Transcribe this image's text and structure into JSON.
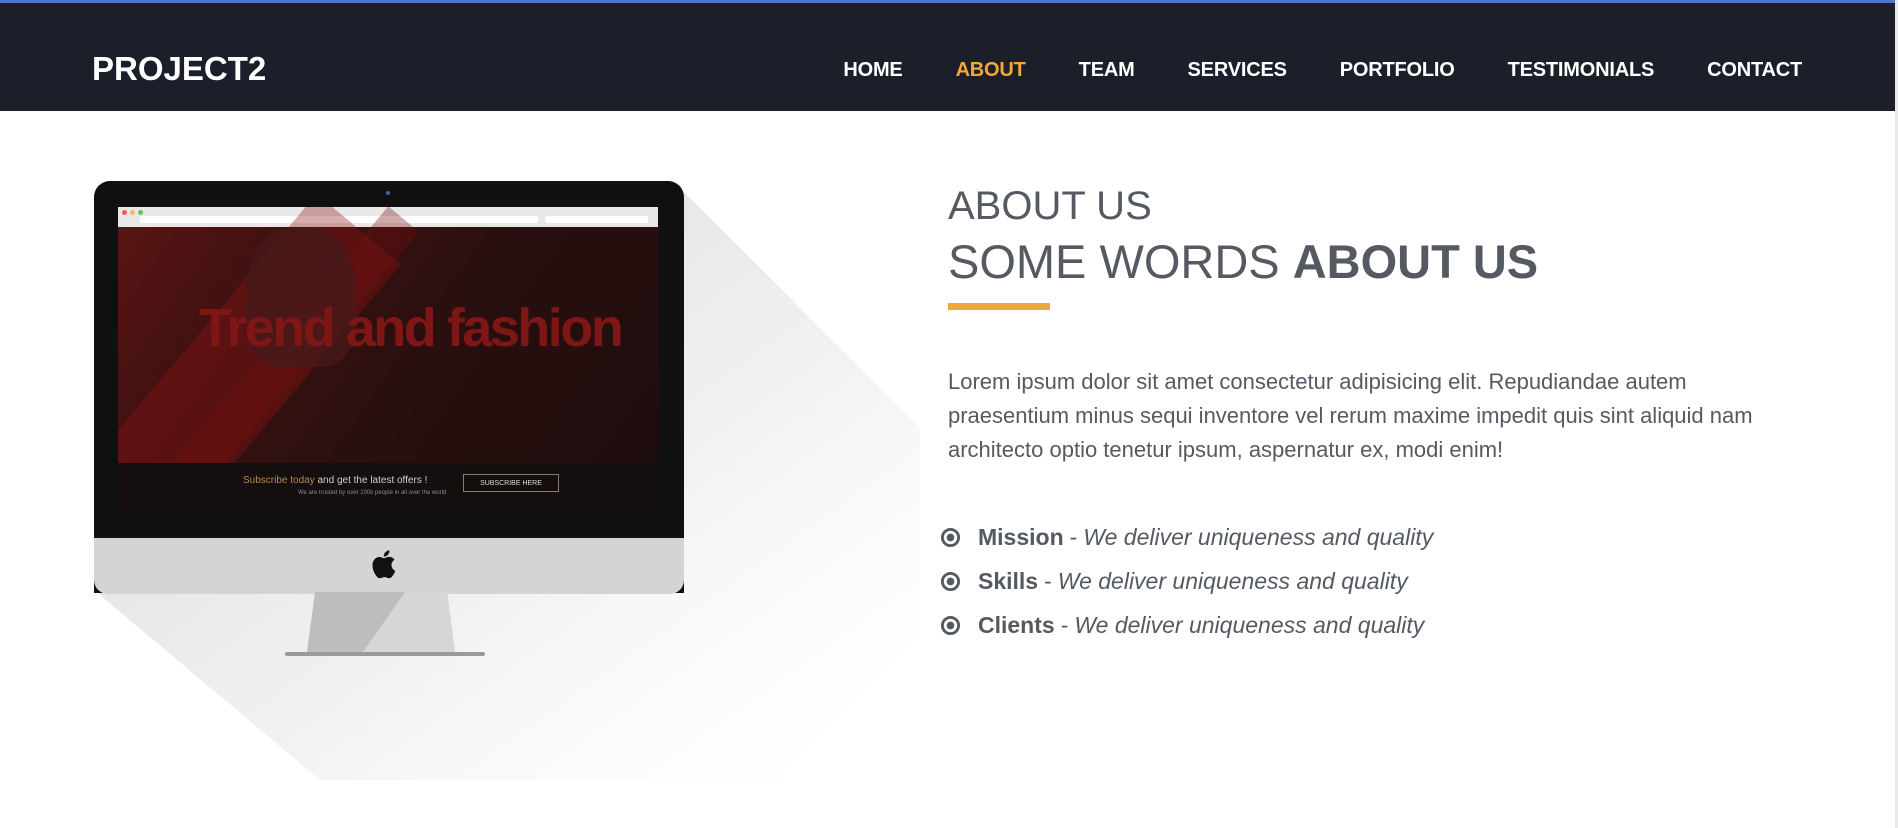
{
  "brand": "PROJECT2",
  "nav": [
    "HOME",
    "ABOUT",
    "TEAM",
    "SERVICES",
    "PORTFOLIO",
    "TESTIMONIALS",
    "CONTACT"
  ],
  "nav_active": "ABOUT",
  "colors": {
    "navbar": "#1c1f29",
    "accent": "#f2a73b",
    "text": "#555a62",
    "topline": "#4a7ac8"
  },
  "mockup": {
    "hero_title": "Trend and fashion",
    "subscribe_text_highlight": "Subscribe today",
    "subscribe_text_rest": " and get the latest offers !",
    "subscribe_small_text": "We are trusted by over 100k people in all over the world",
    "subscribe_button": "SUBSCRIBE HERE"
  },
  "about": {
    "kicker": "ABOUT US",
    "heading_light": "SOME WORDS ",
    "heading_bold": "ABOUT US",
    "paragraph": "Lorem ipsum dolor sit amet consectetur adipisicing elit. Repudiandae autem praesentium minus sequi inventore vel rerum maxime impedit quis sint aliquid nam architecto optio tenetur ipsum, aspernatur ex, modi enim!",
    "features": [
      {
        "title": "Mission",
        "sep": "-",
        "desc": "We deliver uniqueness and quality",
        "icon": "dot-circle-icon"
      },
      {
        "title": "Skills",
        "sep": "-",
        "desc": "We deliver uniqueness and quality",
        "icon": "dot-circle-icon"
      },
      {
        "title": "Clients",
        "sep": "-",
        "desc": "We deliver uniqueness and quality",
        "icon": "dot-circle-icon"
      }
    ]
  }
}
